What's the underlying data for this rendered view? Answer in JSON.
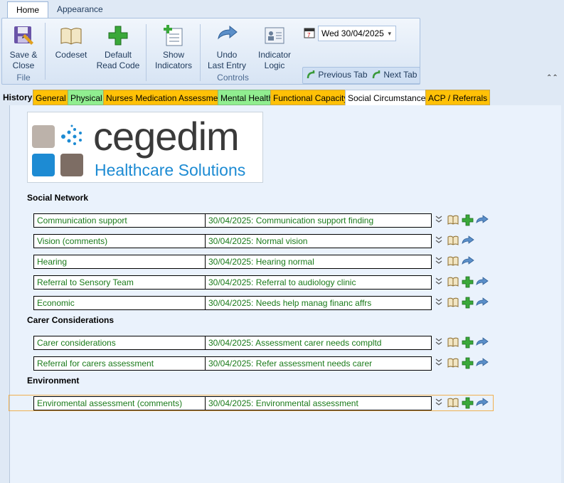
{
  "ribbon": {
    "tabs": [
      "Home",
      "Appearance"
    ],
    "file_group": {
      "label": "File",
      "save_close": "Save &\nClose"
    },
    "controls_group": {
      "label": "Controls",
      "codeset": "Codeset",
      "default_read_code": "Default\nRead Code",
      "show_indicators": "Show\nIndicators",
      "undo_last_entry": "Undo\nLast Entry",
      "indicator_logic": "Indicator\nLogic",
      "date": "Wed 30/04/2025",
      "previous_tab": "Previous Tab",
      "next_tab": "Next Tab"
    }
  },
  "form_tabs": [
    {
      "label": "History",
      "color": ""
    },
    {
      "label": "General",
      "color": "#ffc107"
    },
    {
      "label": "Physical",
      "color": "#90ee90"
    },
    {
      "label": "Nurses Medication Assessment",
      "color": "#ffc107"
    },
    {
      "label": "Mental Health",
      "color": "#90ee90"
    },
    {
      "label": "Functional Capacity",
      "color": "#ffc107"
    },
    {
      "label": "Social Circumstances",
      "color": "#ffffff"
    },
    {
      "label": "ACP / Referrals",
      "color": "#ffc107"
    }
  ],
  "logo": {
    "brand": "cegedim",
    "subtitle": "Healthcare Solutions"
  },
  "sections": {
    "social_network": {
      "title": "Social Network",
      "rows": [
        {
          "label": "Communication support",
          "value": "30/04/2025: Communication support finding"
        },
        {
          "label": "Vision (comments)",
          "value": "30/04/2025: Normal vision"
        },
        {
          "label": "Hearing",
          "value": "30/04/2025: Hearing normal"
        },
        {
          "label": "Referral to Sensory Team",
          "value": "30/04/2025: Referral to audiology clinic"
        },
        {
          "label": "Economic",
          "value": "30/04/2025: Needs help manag financ affrs"
        }
      ]
    },
    "carer": {
      "title": "Carer Considerations",
      "rows": [
        {
          "label": "Carer considerations",
          "value": "30/04/2025: Assessment carer needs compltd"
        },
        {
          "label": "Referral for carers assessment",
          "value": "30/04/2025: Refer assessment needs carer"
        }
      ]
    },
    "environment": {
      "title": "Environment",
      "rows": [
        {
          "label": "Enviromental assessment (comments)",
          "value": "30/04/2025: Environmental assessment"
        }
      ]
    }
  }
}
